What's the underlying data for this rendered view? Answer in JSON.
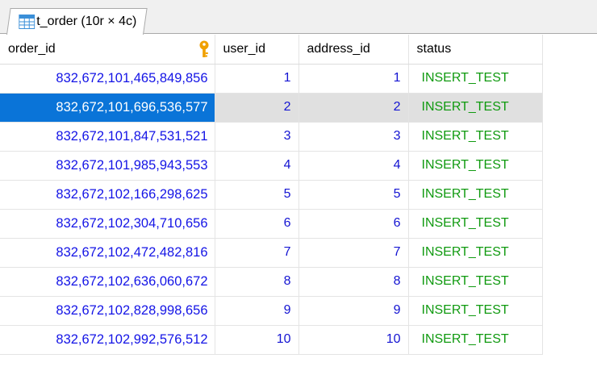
{
  "tab": {
    "title": "t_order (10r × 4c)",
    "icon": "table-grid-icon"
  },
  "columns": [
    {
      "label": "order_id",
      "key_icon": "primary-key-icon"
    },
    {
      "label": "user_id"
    },
    {
      "label": "address_id"
    },
    {
      "label": "status"
    }
  ],
  "rows": [
    {
      "order_id": "832,672,101,465,849,856",
      "user_id": "1",
      "address_id": "1",
      "status": "INSERT_TEST"
    },
    {
      "order_id": "832,672,101,696,536,577",
      "user_id": "2",
      "address_id": "2",
      "status": "INSERT_TEST"
    },
    {
      "order_id": "832,672,101,847,531,521",
      "user_id": "3",
      "address_id": "3",
      "status": "INSERT_TEST"
    },
    {
      "order_id": "832,672,101,985,943,553",
      "user_id": "4",
      "address_id": "4",
      "status": "INSERT_TEST"
    },
    {
      "order_id": "832,672,102,166,298,625",
      "user_id": "5",
      "address_id": "5",
      "status": "INSERT_TEST"
    },
    {
      "order_id": "832,672,102,304,710,656",
      "user_id": "6",
      "address_id": "6",
      "status": "INSERT_TEST"
    },
    {
      "order_id": "832,672,102,472,482,816",
      "user_id": "7",
      "address_id": "7",
      "status": "INSERT_TEST"
    },
    {
      "order_id": "832,672,102,636,060,672",
      "user_id": "8",
      "address_id": "8",
      "status": "INSERT_TEST"
    },
    {
      "order_id": "832,672,102,828,998,656",
      "user_id": "9",
      "address_id": "9",
      "status": "INSERT_TEST"
    },
    {
      "order_id": "832,672,102,992,576,512",
      "user_id": "10",
      "address_id": "10",
      "status": "INSERT_TEST"
    }
  ],
  "selected_row": 1,
  "colors": {
    "selection": "#0a74d8",
    "selected_row_bg": "#e0e0e0",
    "order_id_text": "#1414e6",
    "number_text": "#1414d2",
    "status_text": "#109a10",
    "key_icon": "#f0a000"
  }
}
